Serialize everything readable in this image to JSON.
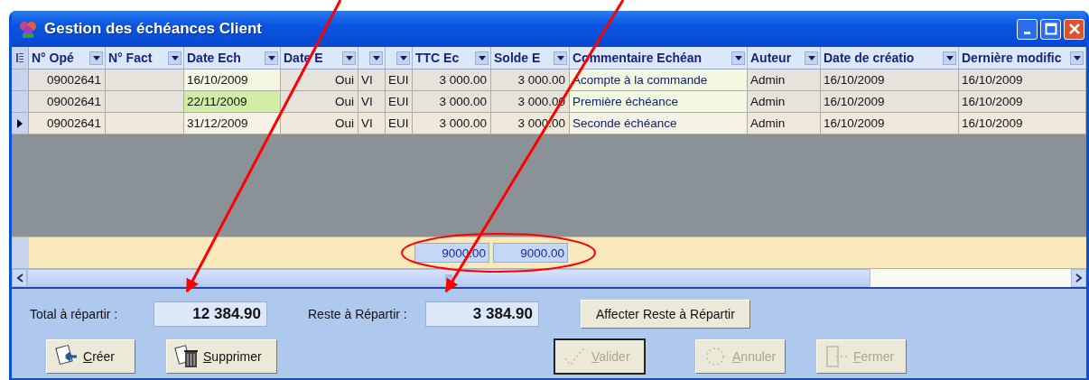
{
  "window": {
    "title": "Gestion des échéances Client"
  },
  "table": {
    "columns": [
      {
        "label": "N° Opé"
      },
      {
        "label": "N° Fact"
      },
      {
        "label": "Date Ech"
      },
      {
        "label": "Date E"
      },
      {},
      {},
      {
        "label": "TTC Ec"
      },
      {
        "label": "Solde E"
      },
      {
        "label": "Commentaire Echéan"
      },
      {
        "label": "Auteur"
      },
      {
        "label": "Date de créatio"
      },
      {
        "label": "Dernière modific"
      }
    ],
    "rows": [
      {
        "selected": false,
        "highlighted": false,
        "cells": [
          "09002641",
          null,
          "16/10/2009",
          "Oui",
          "VI",
          "EUI",
          "3 000.00",
          "3 000.00",
          "Acompte à la commande",
          "Admin",
          "16/10/2009",
          "16/10/2009"
        ]
      },
      {
        "selected": false,
        "highlighted": true,
        "cells": [
          "09002641",
          null,
          "22/11/2009",
          "Oui",
          "VI",
          "EUI",
          "3 000.00",
          "3 000.00",
          "Première échéance",
          "Admin",
          "16/10/2009",
          "16/10/2009"
        ]
      },
      {
        "selected": true,
        "highlighted": false,
        "cells": [
          "09002641",
          null,
          "31/12/2009",
          "Oui",
          "VI",
          "EUI",
          "3 000.00",
          "3 000.00",
          "Seconde échéance",
          "Admin",
          "16/10/2009",
          "16/10/2009"
        ]
      }
    ],
    "totals": [
      {
        "value": "9000.00"
      },
      {
        "value": "9000.00"
      }
    ]
  },
  "fields": [
    {
      "label": "Total à répartir :",
      "value": "12 384.90"
    },
    {
      "label": "Reste à Répartir :",
      "value": "3 384.90"
    }
  ],
  "assign_button": {
    "label": "Affecter Reste à Répartir"
  },
  "buttons": [
    {
      "label": "Créer",
      "kind": "create",
      "disabled": false,
      "default": false
    },
    {
      "label": "Supprimer",
      "kind": "delete",
      "disabled": false,
      "default": false
    },
    {
      "label": "Valider",
      "kind": "validate",
      "disabled": true,
      "default": true
    },
    {
      "label": "Annuler",
      "kind": "cancel",
      "disabled": true,
      "default": false
    },
    {
      "label": "Fermer",
      "kind": "close",
      "disabled": true,
      "default": false
    }
  ]
}
